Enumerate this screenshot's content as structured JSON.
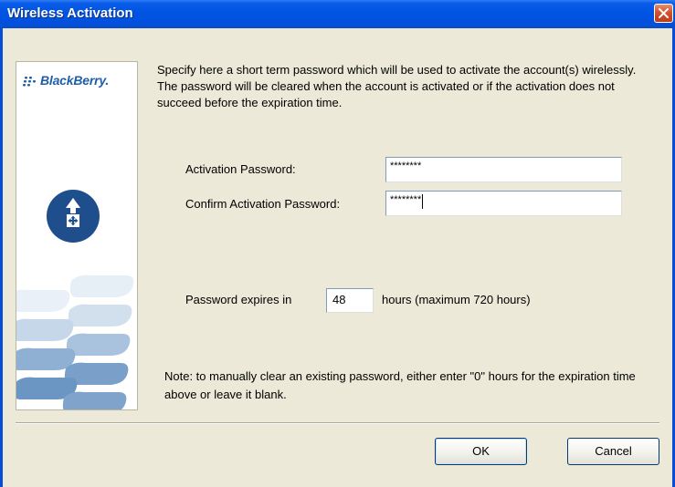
{
  "window": {
    "title": "Wireless Activation"
  },
  "banner": {
    "brand": "BlackBerry."
  },
  "description": "Specify here a short term password which will be used to activate the account(s) wirelessly. The password will be cleared when the account is activated or if the activation does not succeed before the expiration time.",
  "form": {
    "activation_password_label": "Activation Password:",
    "activation_password_value": "********",
    "confirm_password_label": "Confirm Activation Password:",
    "confirm_password_value": "********",
    "expires_prefix": "Password expires in",
    "expires_value": "48",
    "expires_suffix": "hours (maximum 720 hours)"
  },
  "note": "Note: to manually clear an existing password, either enter \"0\" hours for the expiration time above or leave it blank.",
  "buttons": {
    "ok": "OK",
    "cancel": "Cancel"
  },
  "colors": {
    "titlebar": "#0054e3",
    "dialog_bg": "#ece9d8",
    "brand_blue": "#1f4e8c"
  },
  "icons": {
    "close": "close-icon",
    "brand": "blackberry-logo",
    "activation": "arrows-icon"
  }
}
